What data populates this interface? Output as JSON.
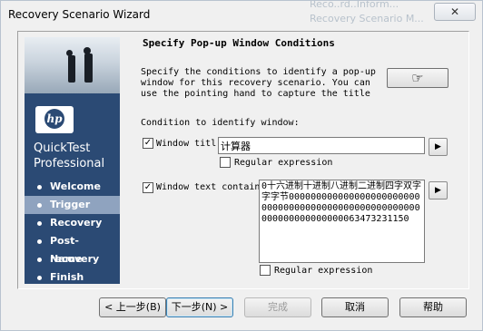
{
  "window": {
    "title": "Recovery Scenario Wizard",
    "close_label": "✕",
    "background_text": [
      "Reco..rd..Inform...",
      "Recovery Scenario M...",
      "..."
    ]
  },
  "sidebar": {
    "logo_text": "hp",
    "product_line1": "QuickTest",
    "product_line2": "Professional",
    "steps": [
      {
        "label": "Welcome",
        "active": false
      },
      {
        "label": "Trigger",
        "active": true
      },
      {
        "label": "Recovery",
        "active": false
      },
      {
        "label": "Post-recovery",
        "active": false
      },
      {
        "label": "Name",
        "active": false
      },
      {
        "label": "Finish",
        "active": false
      }
    ]
  },
  "main": {
    "heading": "Specify Pop-up Window Conditions",
    "description": "Specify the conditions to identify a pop-up window for this recovery scenario. You can use the pointing hand to capture the title",
    "pointing_hand_icon": "pointing-hand-icon",
    "condition_label": "Condition to identify window:",
    "window_title": {
      "checked": true,
      "label": "Window titl",
      "value": "计算器",
      "regex_label": "Regular expression",
      "regex_checked": false
    },
    "window_text": {
      "checked": true,
      "label": "Window text contain",
      "value": "0十六进制十进制八进制二进制四字双字字字节00000000000000000000000000000000000000000000000000000000000000000000063473231150",
      "regex_label": "Regular expression",
      "regex_checked": false
    }
  },
  "buttons": {
    "back": "< 上一步(B)",
    "next": "下一步(N) >",
    "finish": "完成",
    "cancel": "取消",
    "help": "帮助"
  }
}
